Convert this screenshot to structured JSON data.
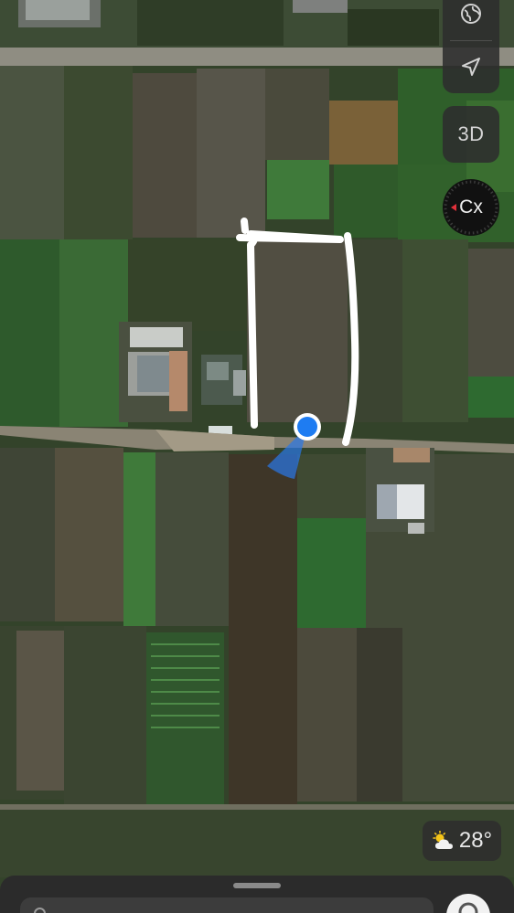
{
  "map": {
    "mode": "satellite",
    "controls": {
      "globe_icon": "globe-icon",
      "location_icon": "location-arrow-icon",
      "three_d_label": "3D",
      "compass_label": "Cx",
      "compass_needle_color": "#e0303a"
    },
    "user_location": {
      "dot_color": "#1e7cf2",
      "beam_color": "#2a78e8"
    },
    "drawn_outline_color": "#ffffff"
  },
  "weather": {
    "icon": "partly-sunny-icon",
    "temperature": "28°"
  },
  "bottom_sheet": {
    "search_icon": "search-icon"
  }
}
